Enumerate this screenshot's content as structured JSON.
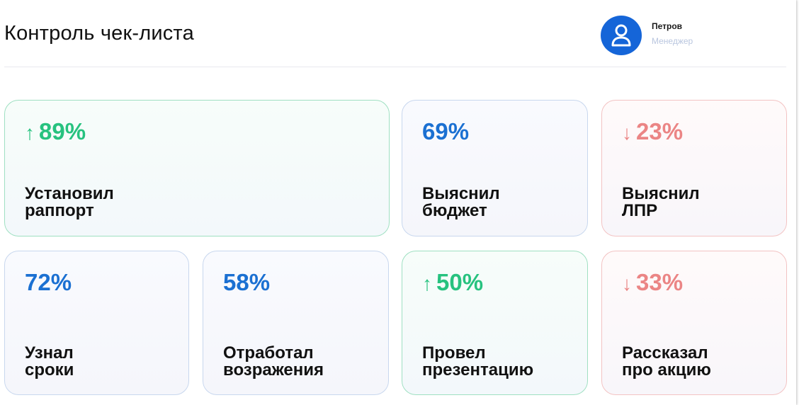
{
  "header": {
    "title": "Контроль чек-листа",
    "user": {
      "name": "Петров",
      "role": "Менеджер",
      "avatar_icon": "user-icon"
    }
  },
  "colors": {
    "blue": "#1b70d2",
    "green": "#27c27f",
    "red": "#eb8585",
    "avatar": "#1565d8"
  },
  "cards": [
    {
      "value": "89%",
      "trend": "↑",
      "tone": "green",
      "label_line1": "Установил",
      "label_line2": "раппорт"
    },
    {
      "value": "69%",
      "trend": "",
      "tone": "blue",
      "label_line1": "Выяснил",
      "label_line2": "бюджет"
    },
    {
      "value": "23%",
      "trend": "↓",
      "tone": "red",
      "label_line1": "Выяснил",
      "label_line2": "ЛПР"
    },
    {
      "value": "72%",
      "trend": "",
      "tone": "blue",
      "label_line1": "Узнал",
      "label_line2": "сроки"
    },
    {
      "value": "58%",
      "trend": "",
      "tone": "blue",
      "label_line1": "Отработал",
      "label_line2": "возражения"
    },
    {
      "value": "50%",
      "trend": "↑",
      "tone": "green",
      "label_line1": "Провел",
      "label_line2": "презентацию"
    },
    {
      "value": "33%",
      "trend": "↓",
      "tone": "red",
      "label_line1": "Рассказал",
      "label_line2": "про акцию"
    }
  ]
}
